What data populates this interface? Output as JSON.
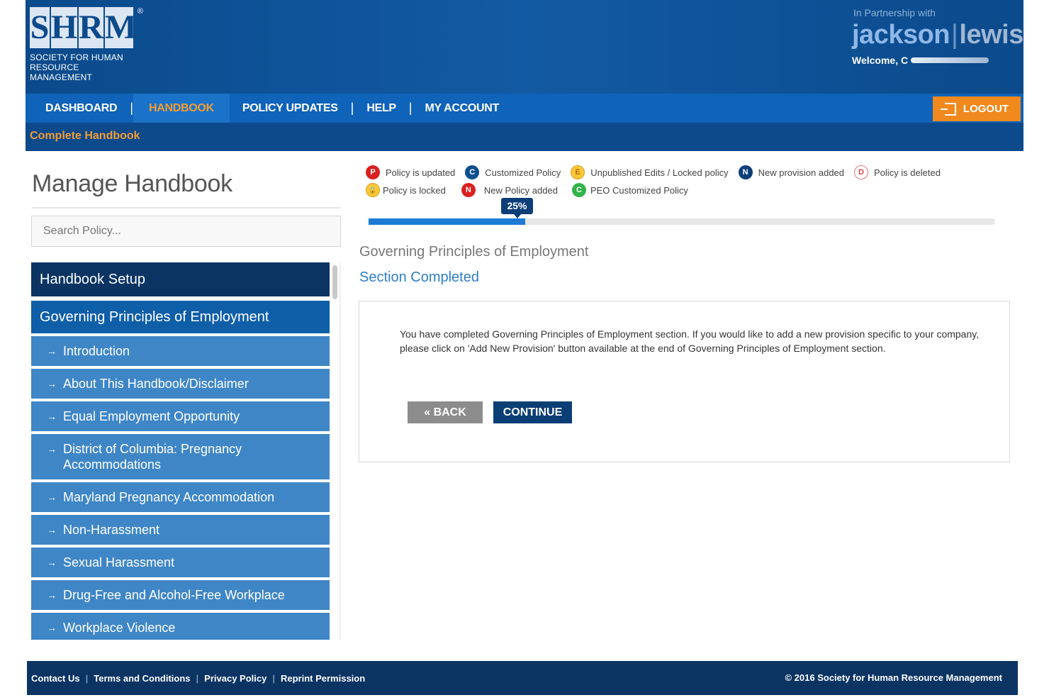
{
  "header": {
    "logo_letters": [
      "S",
      "H",
      "R",
      "M"
    ],
    "logo_reg": "®",
    "logo_sub_line1": "SOCIETY FOR HUMAN",
    "logo_sub_line2": "RESOURCE MANAGEMENT",
    "partner_label": "In Partnership with",
    "partner_brand_1": "jackson",
    "partner_brand_sep": "|",
    "partner_brand_2": "lewis",
    "welcome": "Welcome, C"
  },
  "nav": {
    "items": [
      "DASHBOARD",
      "HANDBOOK",
      "POLICY UPDATES",
      "HELP",
      "MY ACCOUNT"
    ],
    "separator": "|",
    "logout": "LOGOUT"
  },
  "subnav": {
    "label": "Complete Handbook"
  },
  "sidebar": {
    "title": "Manage Handbook",
    "search_placeholder": "Search Policy...",
    "setup_label": "Handbook Setup",
    "section_label": "Governing Principles of Employment",
    "arrow": "→",
    "items": [
      "Introduction",
      "About This Handbook/Disclaimer",
      "Equal Employment Opportunity",
      "District of Columbia: Pregnancy Accommodations",
      "Maryland Pregnancy Accommodation",
      "Non-Harassment",
      "Sexual Harassment",
      "Drug-Free and Alcohol-Free Workplace",
      "Workplace Violence"
    ]
  },
  "legend": {
    "row1": [
      {
        "badge": "P",
        "label": "Policy is updated",
        "style": "b-red"
      },
      {
        "badge": "C",
        "label": "Customized Policy",
        "style": "b-blue"
      },
      {
        "badge": "E",
        "label": "Unpublished Edits / Locked policy",
        "style": "b-yellow"
      },
      {
        "badge": "N",
        "label": "New provision added",
        "style": "b-navy"
      },
      {
        "badge": "D",
        "label": "Policy is deleted",
        "style": "b-outline"
      }
    ],
    "row2": [
      {
        "badge": "🔒",
        "label": "Policy is locked",
        "style": "b-yellow"
      },
      {
        "badge": "N",
        "label": "New Policy added",
        "style": "b-red"
      },
      {
        "badge": "C",
        "label": "PEO Customized Policy",
        "style": "b-green"
      }
    ]
  },
  "progress": {
    "label": "25%",
    "value": 25
  },
  "main": {
    "section_title": "Governing Principles of Employment",
    "status": "Section Completed",
    "message": "You have completed Governing Principles of Employment section. If you would like to add a new provision specific to your company, please click on 'Add New Provision' button available at the end of Governing Principles of Employment section.",
    "back_label": "« BACK",
    "continue_label": "CONTINUE"
  },
  "footer": {
    "links": [
      "Contact Us",
      "Terms and Conditions",
      "Privacy Policy",
      "Reprint Permission"
    ],
    "separator": "|",
    "copyright": "© 2016 Society for Human Resource Management"
  },
  "colors": {
    "header_blue": "#0d4a8c",
    "nav_blue": "#0f63b8",
    "accent_orange": "#f39c34",
    "sidebar_dark": "#0b3463",
    "sidebar_item": "#3f86c6",
    "progress_blue": "#1c7bd4"
  }
}
